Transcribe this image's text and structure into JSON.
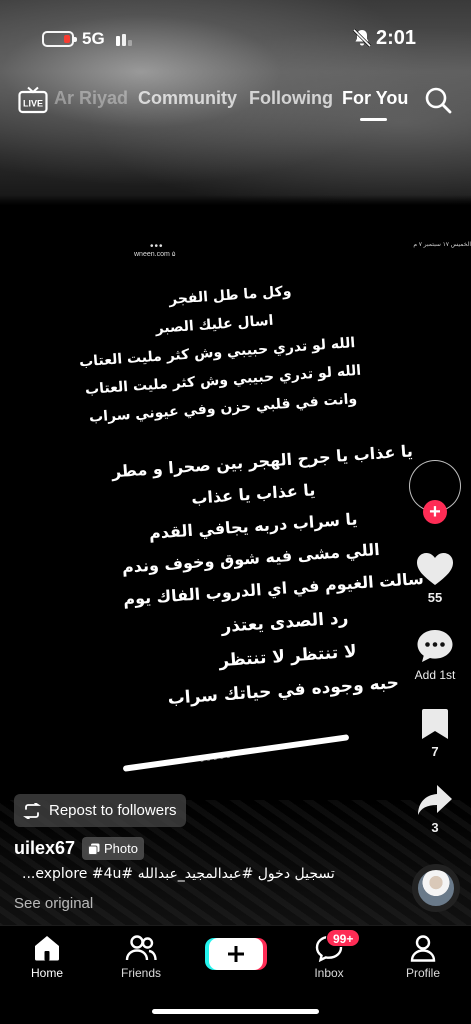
{
  "status_bar": {
    "network": "5G",
    "time": "2:01",
    "battery_color": "#ff3b30"
  },
  "top_nav": {
    "live_label": "LIVE",
    "tabs": [
      {
        "label": "Ar Riyad",
        "state": "faded"
      },
      {
        "label": "Community",
        "state": "inactive"
      },
      {
        "label": "Following",
        "state": "inactive"
      },
      {
        "label": "For You",
        "state": "active"
      }
    ],
    "search_icon": "search-icon"
  },
  "post": {
    "watermark": "wneen.com ۵",
    "watermark_dots": "•••",
    "corner_note": "الخميس ١٧ سبتمبر  ٧ م",
    "poem_lines": [
      "وكل ما طل الفجر",
      "اسال عليك الصبر",
      "الله لو تدري حبيبي وش كثر مليت العتاب",
      "الله لو تدري حبيبي وش كثر مليت العتاب",
      "وانت في قلبي حزن وفي عيوني سراب",
      "يا عذاب يا جرح الهجر بين صحرا و مطر",
      "يا عذاب يا عذاب",
      "يا سراب دربه يجافي القدم",
      "اللي مشى فيه شوق وخوف وندم",
      "سالت الغيوم في اي الدروب الفاك يوم",
      "رد الصدى يعتذر",
      "لا تنتظر لا تنتظر",
      "حبه وجوده في حياتك سراب"
    ],
    "underline_text": "- - - - -"
  },
  "right_rail": {
    "like_count": "55",
    "comment_label": "Add 1st",
    "bookmark_count": "7",
    "share_count": "3",
    "accent": "#fe2c55"
  },
  "caption": {
    "repost_label": "Repost to followers",
    "username": "uilex67",
    "photo_badge": "Photo",
    "text": "تسجيل دخول #عبدالمجيد_عبدالله #explore #4u...",
    "see_original": "See original"
  },
  "bottom_bar": {
    "tabs": [
      {
        "label": "Home",
        "icon": "home-icon"
      },
      {
        "label": "Friends",
        "icon": "friends-icon"
      },
      {
        "label": "",
        "icon": "plus-icon"
      },
      {
        "label": "Inbox",
        "icon": "inbox-icon"
      },
      {
        "label": "Profile",
        "icon": "profile-icon"
      }
    ],
    "inbox_badge": "99+"
  }
}
